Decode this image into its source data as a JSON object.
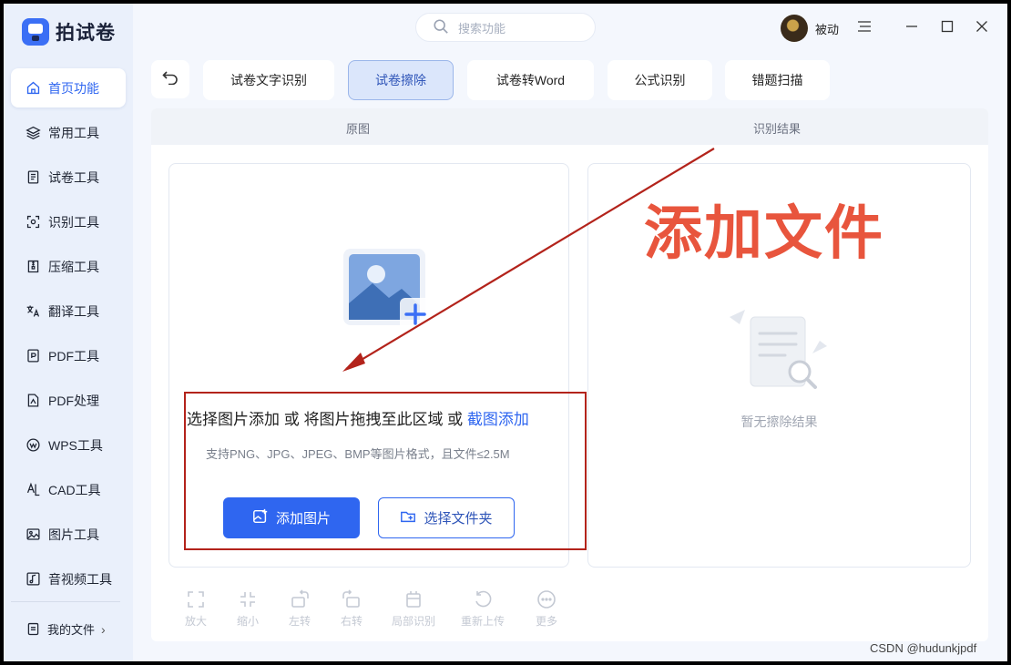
{
  "app": {
    "name": "拍试卷"
  },
  "search": {
    "placeholder": "搜索功能"
  },
  "user": {
    "name": "被动"
  },
  "sidebar": {
    "items": [
      {
        "label": "首页功能",
        "icon": "home-icon",
        "active": true
      },
      {
        "label": "常用工具",
        "icon": "layers-icon"
      },
      {
        "label": "试卷工具",
        "icon": "paper-icon"
      },
      {
        "label": "识别工具",
        "icon": "scan-icon"
      },
      {
        "label": "压缩工具",
        "icon": "compress-icon"
      },
      {
        "label": "翻译工具",
        "icon": "translate-icon"
      },
      {
        "label": "PDF工具",
        "icon": "pdf-icon"
      },
      {
        "label": "PDF处理",
        "icon": "pdf-edit-icon"
      },
      {
        "label": "WPS工具",
        "icon": "wps-icon"
      },
      {
        "label": "CAD工具",
        "icon": "cad-icon"
      },
      {
        "label": "图片工具",
        "icon": "image-icon"
      },
      {
        "label": "音视频工具",
        "icon": "music-icon"
      }
    ],
    "my_files": "我的文件"
  },
  "tabs": [
    {
      "label": "试卷文字识别"
    },
    {
      "label": "试卷擦除",
      "active": true
    },
    {
      "label": "试卷转Word"
    },
    {
      "label": "公式识别"
    },
    {
      "label": "错题扫描"
    }
  ],
  "panel": {
    "left_header": "原图",
    "right_header": "识别结果",
    "upload": {
      "text_part1": "选择图片添加 或 将图片拖拽至此区域 或 ",
      "link": "截图添加",
      "hint": "支持PNG、JPG、JPEG、BMP等图片格式，且文件≤2.5M",
      "add_image_label": "添加图片",
      "choose_folder_label": "选择文件夹"
    },
    "empty_result": "暂无擦除结果"
  },
  "toolbar": [
    {
      "label": "放大",
      "icon": "expand-icon"
    },
    {
      "label": "缩小",
      "icon": "shrink-icon"
    },
    {
      "label": "左转",
      "icon": "rotate-left-icon"
    },
    {
      "label": "右转",
      "icon": "rotate-right-icon"
    },
    {
      "label": "局部识别",
      "icon": "partial-icon"
    },
    {
      "label": "重新上传",
      "icon": "reupload-icon"
    },
    {
      "label": "更多",
      "icon": "more-icon"
    }
  ],
  "annotation": {
    "label": "添加文件",
    "color": "#e8553d"
  },
  "watermark": "CSDN @hudunkjpdf",
  "colors": {
    "accent": "#2f66f0",
    "annotation_box": "#b3231b"
  }
}
